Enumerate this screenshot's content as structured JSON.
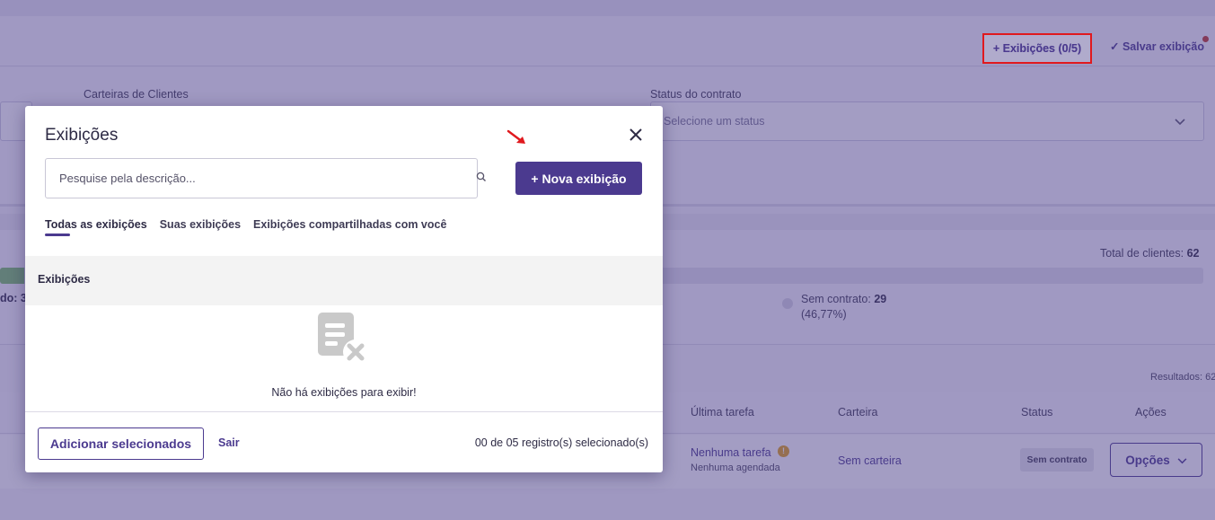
{
  "header": {
    "exibicoes_label": "+ Exibições (0/5)",
    "save_label": "✓ Salvar exibição"
  },
  "filters": {
    "carteiras_label": "Carteiras de Clientes",
    "status_label": "Status do contrato",
    "status_placeholder": "Selecione um status"
  },
  "summary": {
    "total_label": "Total de clientes:",
    "total_value": "62",
    "left_legend": "do: 3",
    "sem_contrato_label": "Sem contrato:",
    "sem_contrato_value": "29",
    "sem_contrato_pct": "(46,77%)"
  },
  "results": {
    "label": "Resultados: 62"
  },
  "table": {
    "headers": [
      "Última tarefa",
      "Carteira",
      "Status",
      "Ações"
    ],
    "row": {
      "task": "Nenhuma tarefa",
      "task_sub": "Nenhuma agendada",
      "carteira": "Sem carteira",
      "status": "Sem contrato",
      "actions": "Opções"
    }
  },
  "modal": {
    "title": "Exibições",
    "search_placeholder": "Pesquise pela descrição...",
    "new_button": "+ Nova exibição",
    "tabs": [
      "Todas as exibições",
      "Suas exibições",
      "Exibições compartilhadas com você"
    ],
    "list_header": "Exibições",
    "empty_message": "Não há exibições para exibir!",
    "add_selected": "Adicionar selecionados",
    "exit": "Sair",
    "selected_count": "00 de 05 registro(s) selecionado(s)"
  },
  "colors": {
    "brand": "#4b3a8f",
    "highlight": "#e0191e",
    "progress_fill": "#7cc16b"
  },
  "progress": {
    "fraction_visible": 0.02
  },
  "icons": [
    "close-icon",
    "search-icon",
    "empty-list-icon",
    "chevron-down-icon",
    "warning-icon",
    "annotation-arrow"
  ]
}
